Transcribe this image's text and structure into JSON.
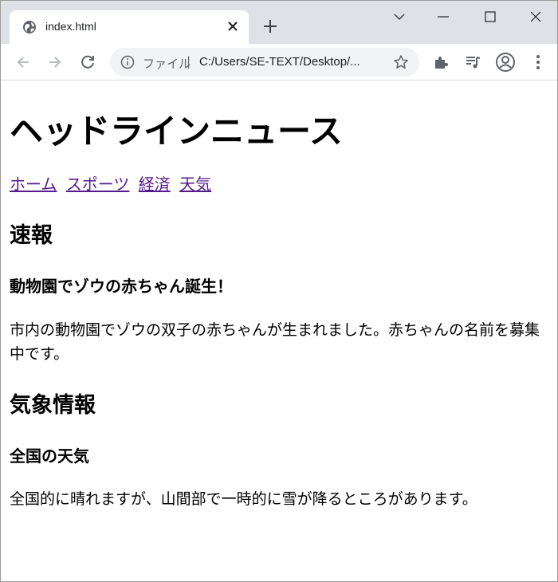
{
  "browser": {
    "tab_title": "index.html",
    "address_scheme": "ファイル",
    "address_separator": "|",
    "address_url": "C:/Users/SE-TEXT/Desktop/...",
    "icons": [
      "globe-icon",
      "close-icon",
      "plus-icon",
      "chevron-down-icon",
      "minimize-icon",
      "maximize-icon",
      "window-close-icon",
      "back-arrow-icon",
      "forward-arrow-icon",
      "reload-icon",
      "info-icon",
      "star-icon",
      "puzzle-icon",
      "media-icon",
      "profile-icon",
      "kebab-menu-icon"
    ]
  },
  "page": {
    "headline": "ヘッドラインニュース",
    "nav": [
      "ホーム",
      "スポーツ",
      "経済",
      "天気"
    ],
    "sections": [
      {
        "heading": "速報",
        "subheading": "動物園でゾウの赤ちゃん誕生！",
        "body": "市内の動物園でゾウの双子の赤ちゃんが生まれました。赤ちゃんの名前を募集中です。"
      },
      {
        "heading": "気象情報",
        "subheading": "全国の天気",
        "body": "全国的に晴れますが、山間部で一時的に雪が降るところがあります。"
      }
    ],
    "link_color": "#551a8b"
  }
}
